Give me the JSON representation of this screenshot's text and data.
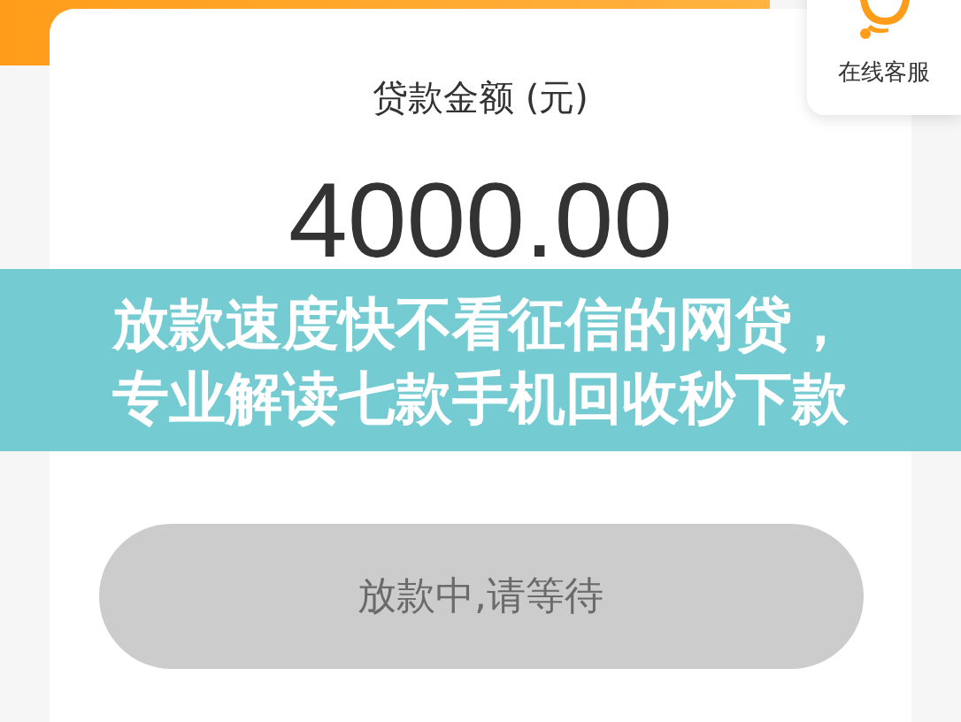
{
  "service_widget": {
    "label": "在线客服"
  },
  "loan_card": {
    "label": "贷款金额 (元)",
    "amount": "4000.00",
    "button": {
      "label": "放款中,请等待",
      "disabled": true
    }
  },
  "overlay_caption": {
    "lines": [
      "放款速度快不看征信的网贷，",
      "专业解读七款手机回收秒下款"
    ]
  }
}
